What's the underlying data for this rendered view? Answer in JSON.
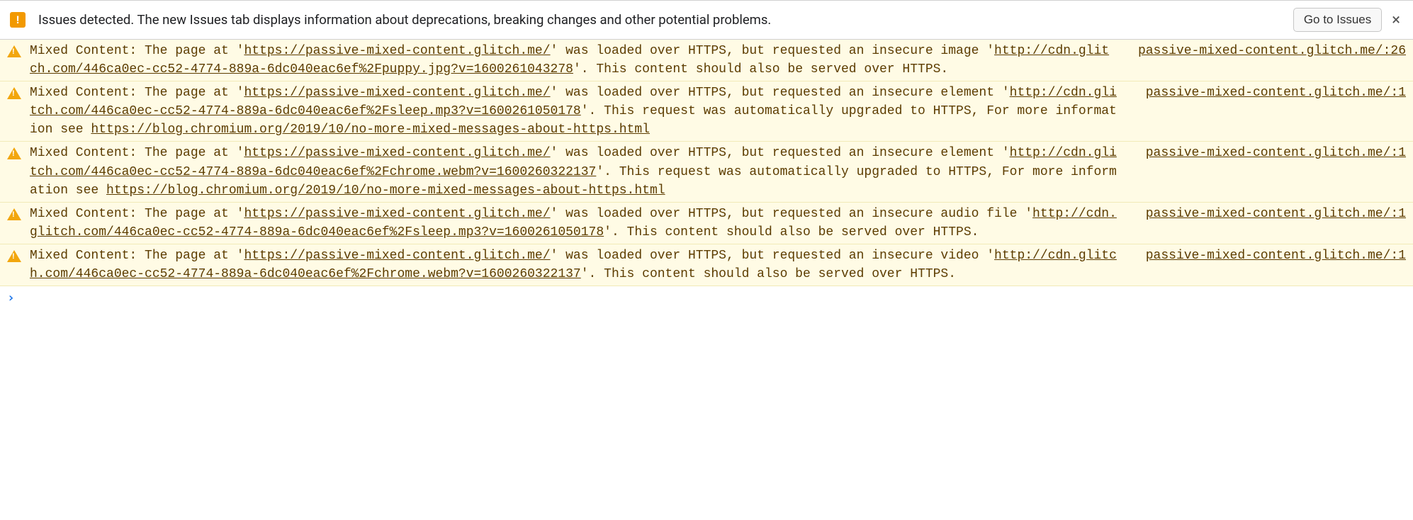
{
  "issues_bar": {
    "text": "Issues detected. The new Issues tab displays information about deprecations, breaking changes and other potential problems.",
    "button_label": "Go to Issues",
    "close_label": "×"
  },
  "page_url": "https://passive-mixed-content.glitch.me/",
  "info_link": "https://blog.chromium.org/2019/10/no-more-mixed-messages-about-https.html",
  "messages": [
    {
      "source": "passive-mixed-content.glitch.me/:26",
      "t_pre": "Mixed Content: The page at '",
      "t_mid": "' was loaded over HTTPS, but requested an insecure image '",
      "resource": "http://cdn.glitch.com/446ca0ec-cc52-4774-889a-6dc040eac6ef%2Fpuppy.jpg?v=1600261043278",
      "t_post": "'. This content should also be served over HTTPS."
    },
    {
      "source": "passive-mixed-content.glitch.me/:1",
      "t_pre": "Mixed Content: The page at '",
      "t_mid": "' was loaded over HTTPS, but requested an insecure element '",
      "resource": "http://cdn.glitch.com/446ca0ec-cc52-4774-889a-6dc040eac6ef%2Fsleep.mp3?v=1600261050178",
      "t_post": "'. This request was automatically upgraded to HTTPS, For more information see "
    },
    {
      "source": "passive-mixed-content.glitch.me/:1",
      "t_pre": "Mixed Content: The page at '",
      "t_mid": "' was loaded over HTTPS, but requested an insecure element '",
      "resource": "http://cdn.glitch.com/446ca0ec-cc52-4774-889a-6dc040eac6ef%2Fchrome.webm?v=1600260322137",
      "t_post": "'. This request was automatically upgraded to HTTPS, For more information see "
    },
    {
      "source": "passive-mixed-content.glitch.me/:1",
      "t_pre": "Mixed Content: The page at '",
      "t_mid": "' was loaded over HTTPS, but requested an insecure audio file '",
      "resource": "http://cdn.glitch.com/446ca0ec-cc52-4774-889a-6dc040eac6ef%2Fsleep.mp3?v=1600261050178",
      "t_post": "'. This content should also be served over HTTPS."
    },
    {
      "source": "passive-mixed-content.glitch.me/:1",
      "t_pre": "Mixed Content: The page at '",
      "t_mid": "' was loaded over HTTPS, but requested an insecure video '",
      "resource": "http://cdn.glitch.com/446ca0ec-cc52-4774-889a-6dc040eac6ef%2Fchrome.webm?v=1600260322137",
      "t_post": "'. This content should also be served over HTTPS."
    }
  ],
  "info_link_indices": [
    1,
    2
  ],
  "prompt": "›"
}
